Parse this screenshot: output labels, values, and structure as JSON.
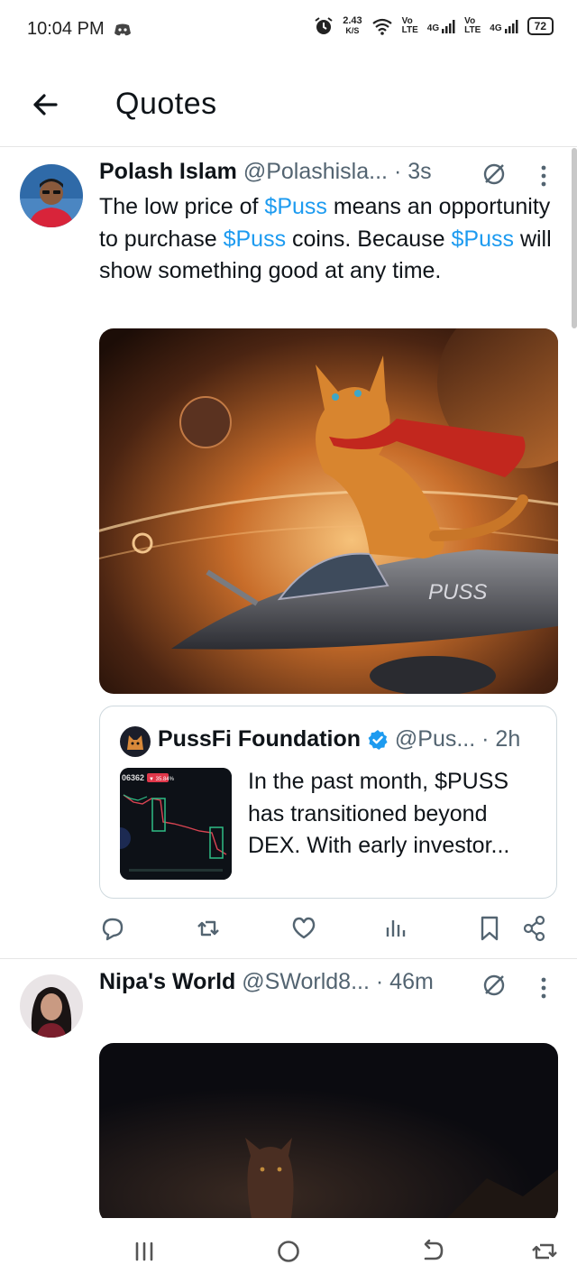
{
  "status_bar": {
    "time": "10:04 PM",
    "net_speed_value": "2.43",
    "net_speed_unit": "K/S",
    "sim1_vo": "Vo",
    "sim1_lte": "LTE",
    "sim1_gen": "4G",
    "sim2_vo": "Vo",
    "sim2_lte": "LTE",
    "sim2_gen": "4G",
    "battery": "72",
    "icons": [
      "discord-icon",
      "alarm-icon",
      "wifi-icon",
      "signal-icon",
      "battery-icon"
    ]
  },
  "header": {
    "title": "Quotes",
    "back_icon": "arrow-left-icon"
  },
  "tweets": [
    {
      "name": "Polash Islam",
      "handle": "@Polashisla...",
      "time": "· 3s",
      "text_parts": [
        "The low price of ",
        "$Puss",
        " means an opportunity to purchase ",
        "$Puss",
        " coins. Because ",
        "$Puss",
        " will show something good at any time."
      ],
      "media_text": "PUSS",
      "quote": {
        "name": "PussFi Foundation",
        "handle": "@Pus...",
        "time": "· 2h",
        "text": "In the past month, $PUSS has transitioned beyond DEX. With early investor...",
        "thumb_price": "06362",
        "thumb_change": "▼ 35.84%"
      },
      "actions": [
        "reply-icon",
        "retweet-icon",
        "like-icon",
        "views-icon",
        "bookmark-icon",
        "share-icon"
      ]
    },
    {
      "name": "Nipa's World",
      "handle": "@SWorld8...",
      "time": "· 46m"
    }
  ],
  "nav_bar": {
    "icons": [
      "recents-icon",
      "home-icon",
      "back-icon",
      "rotate-icon"
    ]
  },
  "colors": {
    "accent": "#1d9bf0",
    "secondary_text": "#536471",
    "verified": "#1d9bf0"
  }
}
